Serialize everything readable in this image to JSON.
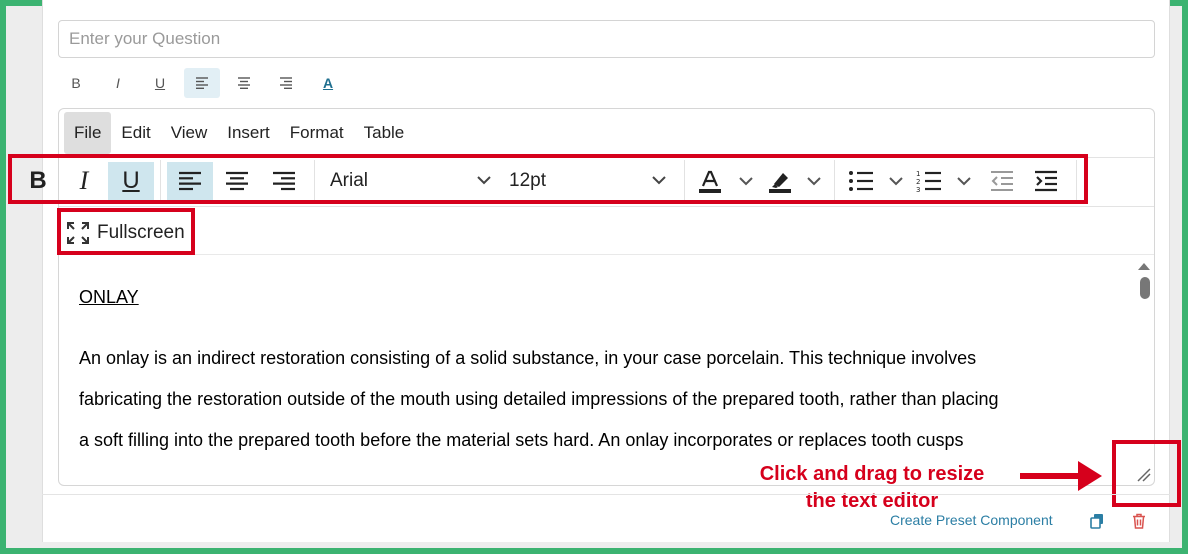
{
  "question": {
    "placeholder": "Enter your Question",
    "value": ""
  },
  "mini_toolbar": {
    "items": [
      {
        "icon": "bold-icon",
        "label": "B"
      },
      {
        "icon": "italic-icon",
        "label": "I"
      },
      {
        "icon": "underline-icon",
        "label": "U"
      },
      {
        "icon": "align-left-icon",
        "active": true
      },
      {
        "icon": "align-center-icon"
      },
      {
        "icon": "align-right-icon"
      },
      {
        "icon": "text-color-icon",
        "label": "A"
      }
    ]
  },
  "editor": {
    "menubar": [
      "File",
      "Edit",
      "View",
      "Insert",
      "Format",
      "Table"
    ],
    "toolbar": {
      "bold_label": "B",
      "italic_label": "I",
      "underline_label": "U",
      "font_family": "Arial",
      "font_size": "12pt"
    },
    "fullscreen_label": "Fullscreen",
    "content": {
      "heading": "ONLAY",
      "lines": [
        "An onlay is an indirect restoration consisting of a solid substance, in your case porcelain.  This technique involves",
        "fabricating the restoration outside of the mouth using detailed impressions of the prepared tooth, rather than placing",
        "a soft filling into the prepared tooth before the material sets hard.  An onlay incorporates or replaces tooth cusps"
      ]
    }
  },
  "annotation": {
    "line1": "Click and drag to resize",
    "line2": "the text editor",
    "color": "#d6001c"
  },
  "footer": {
    "create_preset_label": "Create Preset Component"
  },
  "colors": {
    "border_accent": "#3cb371",
    "active_button": "#cfe6ee",
    "link": "#2b7ea4",
    "delete": "#d9534f"
  }
}
